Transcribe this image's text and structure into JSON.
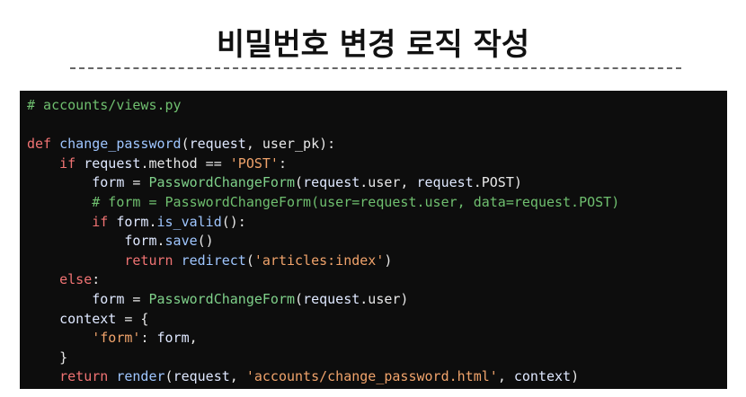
{
  "slide": {
    "title": "비밀번호 변경 로직 작성"
  },
  "code": {
    "lines": [
      "# accounts/views.py",
      "",
      "def change_password(request, user_pk):",
      "    if request.method == 'POST':",
      "        form = PasswordChangeForm(request.user, request.POST)",
      "        # form = PasswordChangeForm(user=request.user, data=request.POST)",
      "        if form.is_valid():",
      "            form.save()",
      "            return redirect('articles:index')",
      "    else:",
      "        form = PasswordChangeForm(request.user)",
      "    context = {",
      "        'form': form,",
      "    }",
      "    return render(request, 'accounts/change_password.html', context)"
    ]
  },
  "colors": {
    "code_background": "#0d0d0d",
    "keyword": "#f07373",
    "function": "#9fc6ff",
    "class": "#7fd18a",
    "string": "#f0a36b",
    "comment": "#6fbf6f"
  }
}
